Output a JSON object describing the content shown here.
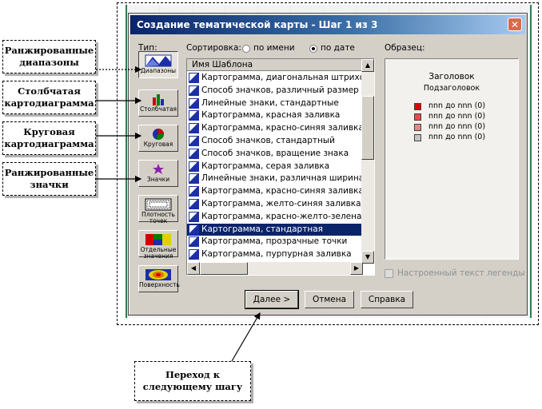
{
  "dialog": {
    "title": "Создание тематической карты - Шаг 1 из 3",
    "close_glyph": "✕"
  },
  "type_label": "Тип:",
  "sort": {
    "label": "Сортировка:",
    "by_name": "по имени",
    "by_date": "по дате",
    "selected": "по дате"
  },
  "types": [
    {
      "label": "Диапазоны",
      "icon": "ranges-icon",
      "pressed": true
    },
    {
      "label": "Столбчатая",
      "icon": "bar-chart-icon",
      "pressed": false
    },
    {
      "label": "Круговая",
      "icon": "pie-chart-icon",
      "pressed": false
    },
    {
      "label": "Значки",
      "icon": "star-symbol-icon",
      "pressed": false
    },
    {
      "label": "Плотность точек",
      "icon": "dot-density-icon",
      "pressed": false
    },
    {
      "label": "Отдельные значения",
      "icon": "individual-values-icon",
      "pressed": false
    },
    {
      "label": "Поверхность",
      "icon": "surface-icon",
      "pressed": false
    }
  ],
  "list": {
    "header": "Имя Шаблона",
    "items": [
      "Картограмма, диагональная штриховка",
      "Способ значков, различный размер",
      "Линейные знаки, стандартные",
      "Картограмма, красная заливка",
      "Картограмма, красно-синяя заливка",
      "Способ значков, стандартный",
      "Способ значков, вращение знака",
      "Картограмма, серая заливка",
      "Линейные знаки, различная ширина",
      "Картограмма, красно-синяя заливка, те",
      "Картограмма, желто-синяя заливка, тем",
      "Картограмма, красно-желто-зеленая за",
      "Картограмма, стандартная",
      "Картограмма, прозрачные точки",
      "Картограмма, пурпурная заливка"
    ],
    "selected_index": 12
  },
  "sample": {
    "label": "Образец:",
    "heading": "Заголовок",
    "subheading": "Подзаголовок",
    "legend": [
      {
        "text": "nnn до nnn   (0)",
        "color": "#e00000"
      },
      {
        "text": "nnn до nnn   (0)",
        "color": "#e84a4a"
      },
      {
        "text": "nnn до nnn   (0)",
        "color": "#e08a8a"
      },
      {
        "text": "nnn до nnn   (0)",
        "color": "#c8c4c4"
      }
    ]
  },
  "custom_legend_text": "Настроенный текст легенды",
  "buttons": {
    "next": "Далее >",
    "cancel": "Отмена",
    "help": "Справка"
  },
  "annotations": {
    "ranges": "Ранжированные диапазоны",
    "bar": "Столбчатая картодиаграмма",
    "pie": "Круговая картодиаграмма",
    "symbols": "Ранжированные значки",
    "next_step": "Переход к следующему шагу"
  }
}
